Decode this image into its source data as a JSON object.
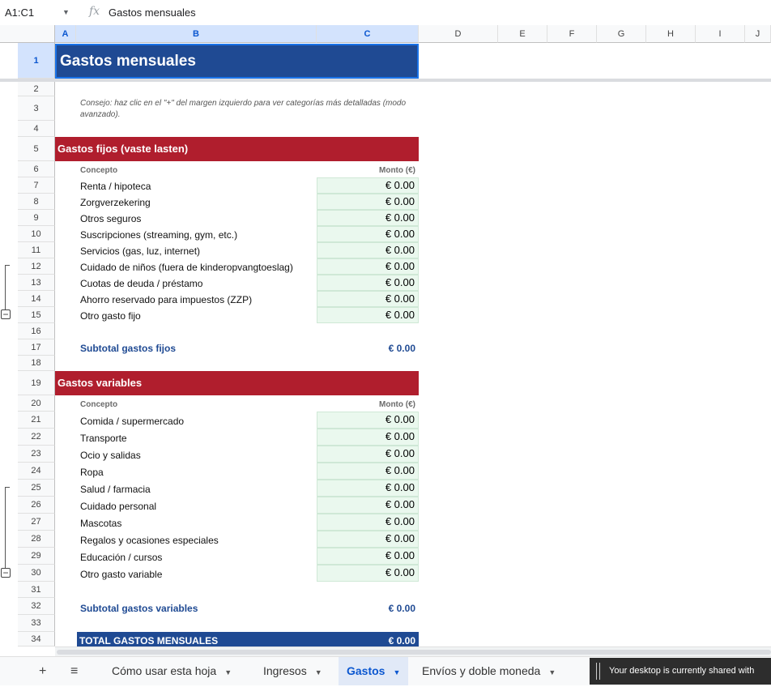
{
  "formula_bar": {
    "name_box": "A1:C1",
    "fx_symbol": "fx",
    "value": "Gastos mensuales"
  },
  "columns": [
    "A",
    "B",
    "C",
    "D",
    "E",
    "F",
    "G",
    "H",
    "I",
    "J"
  ],
  "rows": [
    "1",
    "2",
    "3",
    "4",
    "5",
    "6",
    "7",
    "8",
    "9",
    "10",
    "11",
    "12",
    "13",
    "14",
    "15",
    "16",
    "17",
    "18",
    "19",
    "20",
    "21",
    "22",
    "23",
    "24",
    "25",
    "26",
    "27",
    "28",
    "29",
    "30",
    "31",
    "32",
    "33",
    "34"
  ],
  "title": "Gastos mensuales",
  "tip": "Consejo: haz clic en el \"+\" del margen izquierdo para ver categorías más detalladas (modo avanzado).",
  "fixed": {
    "header": "Gastos fijos (vaste lasten)",
    "col_concept": "Concepto",
    "col_amount": "Monto (€)",
    "items": [
      {
        "label": "Renta / hipoteca",
        "amount": "€ 0.00"
      },
      {
        "label": "Zorgverzekering",
        "amount": "€ 0.00"
      },
      {
        "label": "Otros seguros",
        "amount": "€ 0.00"
      },
      {
        "label": "Suscripciones (streaming, gym, etc.)",
        "amount": "€ 0.00"
      },
      {
        "label": "Servicios (gas, luz, internet)",
        "amount": "€ 0.00"
      },
      {
        "label": "Cuidado de niños (fuera de kinderopvangtoeslag)",
        "amount": "€ 0.00"
      },
      {
        "label": "Cuotas de deuda / préstamo",
        "amount": "€ 0.00"
      },
      {
        "label": "Ahorro reservado para impuestos (ZZP)",
        "amount": "€ 0.00"
      },
      {
        "label": "Otro gasto fijo",
        "amount": "€ 0.00"
      }
    ],
    "subtotal_label": "Subtotal gastos fijos",
    "subtotal_value": "€ 0.00"
  },
  "variable": {
    "header": "Gastos variables",
    "col_concept": "Concepto",
    "col_amount": "Monto (€)",
    "items": [
      {
        "label": "Comida / supermercado",
        "amount": "€ 0.00"
      },
      {
        "label": "Transporte",
        "amount": "€ 0.00"
      },
      {
        "label": "Ocio y salidas",
        "amount": "€ 0.00"
      },
      {
        "label": "Ropa",
        "amount": "€ 0.00"
      },
      {
        "label": "Salud / farmacia",
        "amount": "€ 0.00"
      },
      {
        "label": "Cuidado personal",
        "amount": "€ 0.00"
      },
      {
        "label": "Mascotas",
        "amount": "€ 0.00"
      },
      {
        "label": "Regalos y ocasiones especiales",
        "amount": "€ 0.00"
      },
      {
        "label": "Educación / cursos",
        "amount": "€ 0.00"
      },
      {
        "label": "Otro gasto variable",
        "amount": "€ 0.00"
      }
    ],
    "subtotal_label": "Subtotal gastos variables",
    "subtotal_value": "€ 0.00"
  },
  "total": {
    "label": "TOTAL GASTOS MENSUALES",
    "value": "€ 0.00"
  },
  "tabs": [
    {
      "label": "Cómo usar esta hoja",
      "active": false
    },
    {
      "label": "Ingresos",
      "active": false
    },
    {
      "label": "Gastos",
      "active": true
    },
    {
      "label": "Envíos y doble moneda",
      "active": false
    }
  ],
  "share_banner": "Your desktop is currently shared with",
  "colors": {
    "title_bg": "#1f4a93",
    "section_bg": "#b01e2d",
    "input_bg": "#eaf8ee",
    "accent": "#0b57d0"
  }
}
